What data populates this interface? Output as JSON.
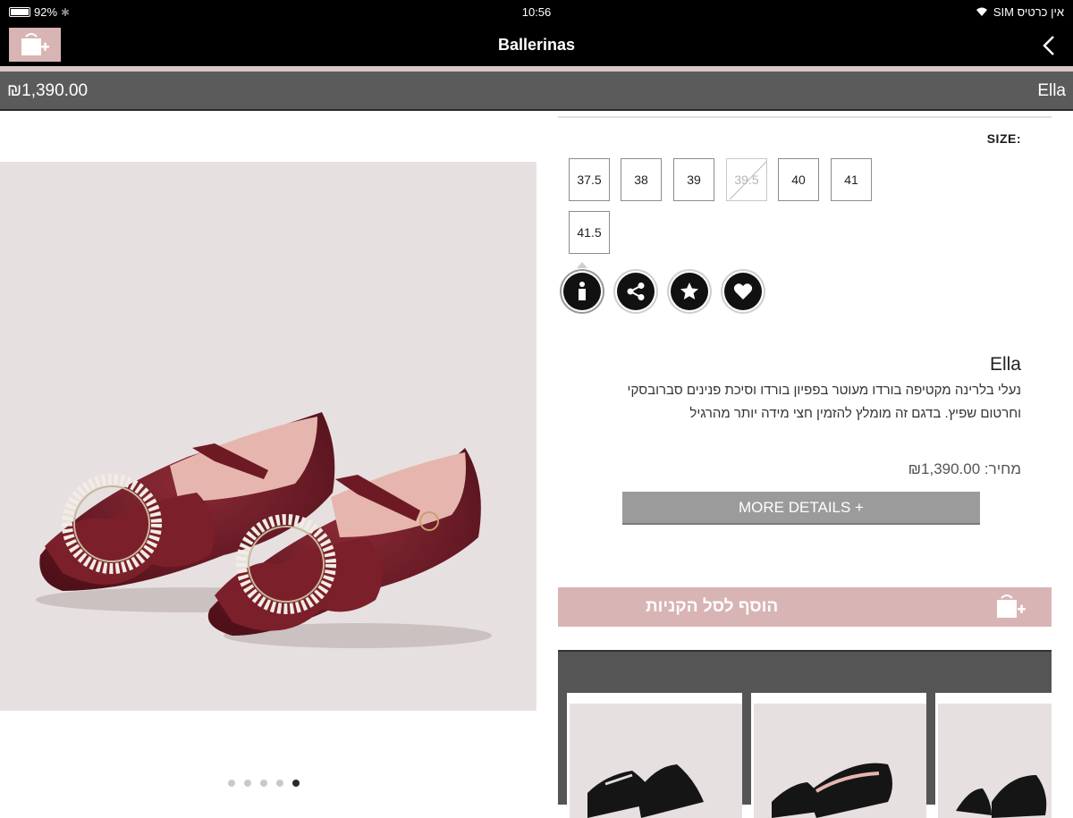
{
  "status_bar": {
    "battery": "92%",
    "time": "10:56",
    "carrier": "אין כרטיס SIM"
  },
  "nav": {
    "title": "Ballerinas"
  },
  "price_bar": {
    "price": "₪1,390.00",
    "name": "Ella"
  },
  "product_images": {
    "count": 5,
    "active_index": 4
  },
  "sizes": {
    "label": "SIZE:",
    "options": [
      {
        "label": "37.5",
        "available": true
      },
      {
        "label": "38",
        "available": true
      },
      {
        "label": "39",
        "available": true
      },
      {
        "label": "39.5",
        "available": false
      },
      {
        "label": "40",
        "available": true
      },
      {
        "label": "41",
        "available": true
      },
      {
        "label": "41.5",
        "available": true
      }
    ]
  },
  "actions": [
    {
      "icon": "info-icon"
    },
    {
      "icon": "share-icon"
    },
    {
      "icon": "star-icon"
    },
    {
      "icon": "heart-icon"
    }
  ],
  "description": {
    "title": "Ella",
    "text": "נעלי בלרינה מקטיפה בורדו מעוטר בפפיון בורדו וסיכת פנינים סברובסקי וחרטום שפיץ. בדגם זה מומלץ להזמין חצי מידה יותר מהרגיל",
    "price_line": "מחיר: ₪1,390.00"
  },
  "buttons": {
    "more_details": "MORE DETAILS +",
    "add_to_cart": "הוסף לסל הקניות"
  },
  "colors": {
    "accent_pink": "#d8b4b4",
    "bar_gray": "#5b5b5b",
    "product_bg": "#e7e0e0",
    "velvet": "#6e1a25"
  }
}
